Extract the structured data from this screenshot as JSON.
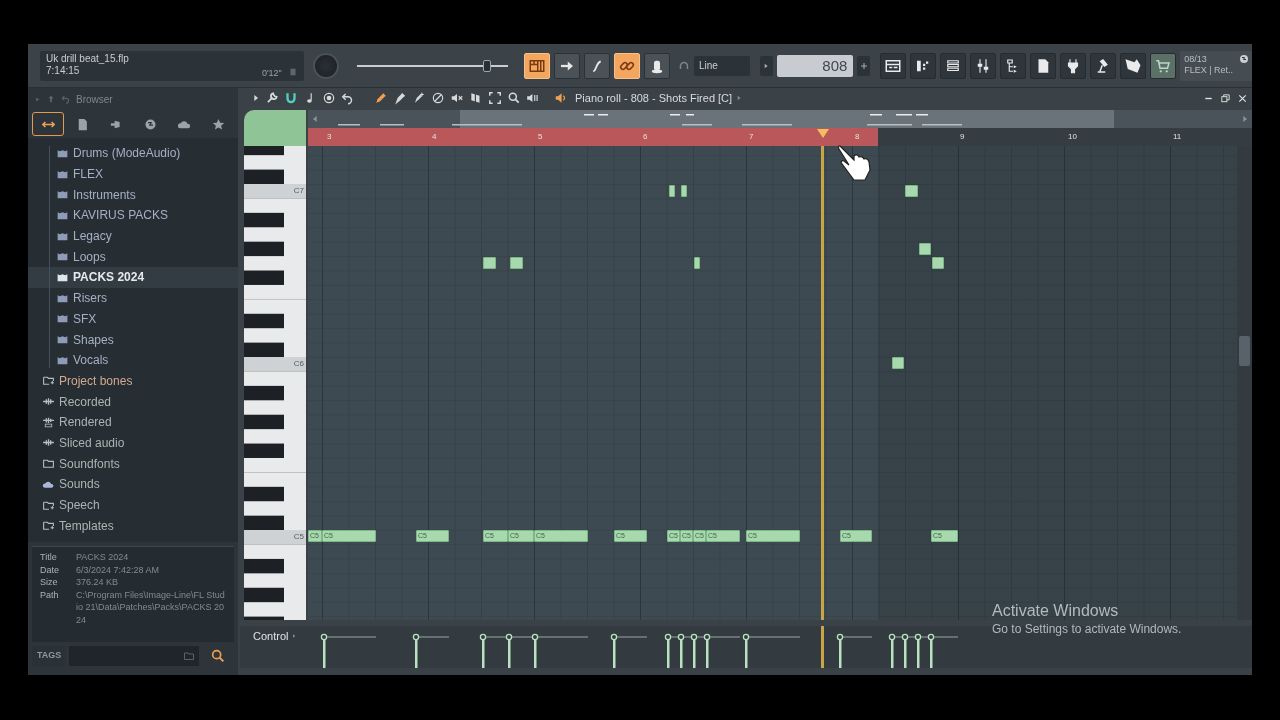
{
  "project": {
    "file": "Uk drill beat_15.flp",
    "time": "7:14:15",
    "duration": "0'12\""
  },
  "master_volume": {
    "level": 0.86
  },
  "toolbar_toggles": [
    {
      "on": true
    },
    {
      "on": false
    },
    {
      "on": false
    },
    {
      "on": true
    },
    {
      "on": false
    }
  ],
  "snap_mode": "Line",
  "pattern": "808",
  "news": {
    "date": "08/13",
    "text": "FLEX | Ret.."
  },
  "browser": {
    "title": "Browser",
    "tabs": [
      {
        "selected": true
      },
      {
        "selected": false
      },
      {
        "selected": false
      },
      {
        "selected": false
      },
      {
        "selected": false
      },
      {
        "selected": false
      }
    ],
    "packs": [
      {
        "label": "Drums (ModeAudio)",
        "selected": false
      },
      {
        "label": "FLEX",
        "selected": false
      },
      {
        "label": "Instruments",
        "selected": false
      },
      {
        "label": "KAVIRUS PACKS",
        "selected": false
      },
      {
        "label": "Legacy",
        "selected": false
      },
      {
        "label": "Loops",
        "selected": false
      },
      {
        "label": "PACKS 2024",
        "selected": true
      },
      {
        "label": "Risers",
        "selected": false
      },
      {
        "label": "SFX",
        "selected": false
      },
      {
        "label": "Shapes",
        "selected": false
      },
      {
        "label": "Vocals",
        "selected": false
      }
    ],
    "folders": [
      {
        "label": "Project bones",
        "kind": "bones",
        "selected": false
      },
      {
        "label": "Recorded",
        "kind": "audio",
        "selected": false
      },
      {
        "label": "Rendered",
        "kind": "render",
        "selected": false
      },
      {
        "label": "Sliced audio",
        "kind": "audio",
        "selected": false
      },
      {
        "label": "Soundfonts",
        "kind": "folder",
        "selected": false
      },
      {
        "label": "Sounds",
        "kind": "cloud",
        "selected": false
      },
      {
        "label": "Speech",
        "kind": "bones",
        "selected": false
      },
      {
        "label": "Templates",
        "kind": "bones",
        "selected": false
      }
    ],
    "info": [
      {
        "label": "Title",
        "value": "PACKS 2024"
      },
      {
        "label": "Date",
        "value": "6/3/2024 7:42:28 AM"
      },
      {
        "label": "Size",
        "value": "376.24 KB"
      },
      {
        "label": "Path",
        "value": "C:\\Program Files\\Image-Line\\FL Studio 21\\Data\\Patches\\Packs\\PACKS 2024"
      }
    ],
    "tags_label": "TAGS"
  },
  "piano_roll": {
    "title": "Piano roll - 808 - Shots Fired [C]",
    "snap": {
      "on": true
    },
    "tools": [
      {
        "selected": true
      },
      {
        "selected": false
      },
      {
        "selected": false
      },
      {
        "selected": false
      },
      {
        "selected": false
      },
      {
        "selected": false
      },
      {
        "selected": false
      },
      {
        "selected": false
      },
      {
        "selected": false
      }
    ],
    "bars": [
      "3",
      "4",
      "5",
      "6",
      "7",
      "8",
      "9",
      "10",
      "11"
    ],
    "keys": [
      "C7",
      "C6",
      "C5"
    ],
    "notes": [
      {
        "label": "C5"
      },
      {
        "label": "C5"
      },
      {
        "label": "C5"
      },
      {
        "label": "C5"
      },
      {
        "label": "C5"
      },
      {
        "label": "C5"
      },
      {
        "label": "C5"
      },
      {
        "label": "C5"
      },
      {
        "label": "C5"
      },
      {
        "label": "C5"
      },
      {
        "label": "C5"
      },
      {
        "label": "C5"
      },
      {
        "label": "C5"
      },
      {
        "label": "C5"
      }
    ],
    "control_label": "Control"
  },
  "activation": {
    "title": "Activate Windows",
    "text": "Go to Settings to activate Windows."
  }
}
